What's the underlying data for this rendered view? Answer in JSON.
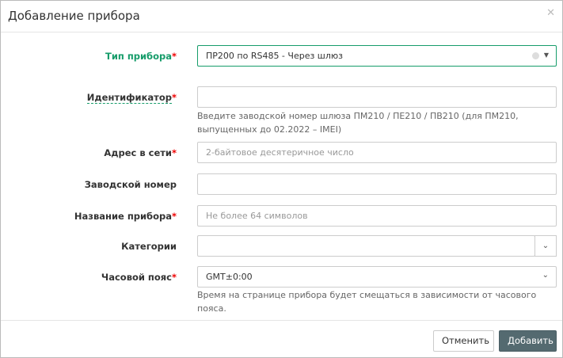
{
  "dialog": {
    "title": "Добавление прибора",
    "close_icon": "close-icon"
  },
  "fields": {
    "type": {
      "label": "Тип прибора",
      "required": "*",
      "value": "ПР200 по RS485 - Через шлюз"
    },
    "identifier": {
      "label": "Идентификатор",
      "required": "*",
      "value": "",
      "help": "Введите заводской номер шлюза ПМ210 / ПЕ210 / ПВ210 (для ПМ210, выпущенных до 02.2022 – IMEI)"
    },
    "address": {
      "label": "Адрес в сети",
      "required": "*",
      "placeholder": "2-байтовое десятеричное число"
    },
    "serial": {
      "label": "Заводской номер",
      "value": ""
    },
    "name": {
      "label": "Название прибора",
      "required": "*",
      "placeholder": "Не более 64 символов"
    },
    "categories": {
      "label": "Категории",
      "value": ""
    },
    "timezone": {
      "label": "Часовой пояс",
      "required": "*",
      "value": "GMT±0:00",
      "help": "Время на странице прибора будет смещаться в зависимости от часового пояса."
    }
  },
  "footer": {
    "cancel_label": "Отменить",
    "add_label": "Добавить"
  },
  "colors": {
    "accent": "#169c6a",
    "primary_button": "#546a70",
    "required": "#ee0000"
  }
}
